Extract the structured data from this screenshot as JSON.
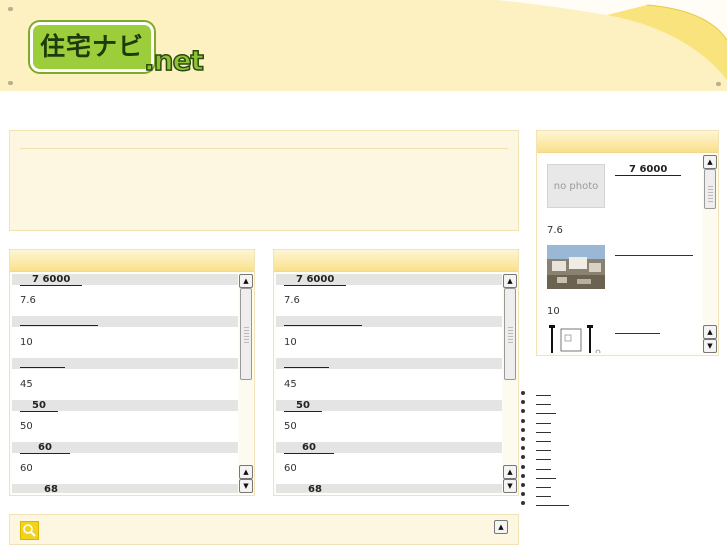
{
  "header": {
    "logo_jp": "住宅ナビ",
    "logo_net": ".net"
  },
  "panel_left": {
    "rows": [
      {
        "type": "link",
        "text": "7  6000"
      },
      {
        "type": "value",
        "text": "7.6"
      },
      {
        "type": "link",
        "text": ""
      },
      {
        "type": "value",
        "text": "10"
      },
      {
        "type": "link",
        "text": ""
      },
      {
        "type": "value",
        "text": "45"
      },
      {
        "type": "link",
        "text": "50"
      },
      {
        "type": "value",
        "text": "50"
      },
      {
        "type": "link",
        "text": "60"
      },
      {
        "type": "value",
        "text": "60"
      },
      {
        "type": "link",
        "text": "68"
      }
    ]
  },
  "panel_mid": {
    "rows": [
      {
        "type": "link",
        "text": "7  6000"
      },
      {
        "type": "value",
        "text": "7.6"
      },
      {
        "type": "link",
        "text": ""
      },
      {
        "type": "value",
        "text": "10"
      },
      {
        "type": "link",
        "text": ""
      },
      {
        "type": "value",
        "text": "45"
      },
      {
        "type": "link",
        "text": "50"
      },
      {
        "type": "value",
        "text": "50"
      },
      {
        "type": "link",
        "text": "60"
      },
      {
        "type": "value",
        "text": "60"
      },
      {
        "type": "link",
        "text": "68"
      }
    ]
  },
  "panel_right": {
    "item1_link": "7  6000",
    "nophoto": "no photo",
    "item1_value": "7.6",
    "item2_value": "10"
  },
  "scroll_up": "▲",
  "scroll_down": "▼"
}
